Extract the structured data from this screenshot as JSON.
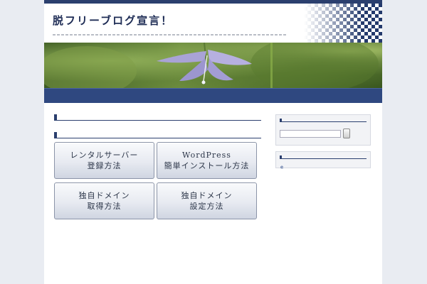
{
  "site": {
    "title": "脱フリーブログ宣言！",
    "description": ""
  },
  "nav": [
    {
      "label": ""
    },
    {
      "label": ""
    },
    {
      "label": ""
    },
    {
      "label": ""
    },
    {
      "label": ""
    },
    {
      "label": ""
    },
    {
      "label": ""
    }
  ],
  "post": {
    "title": "",
    "p1": "",
    "p2_highlight": "",
    "p2": "",
    "p3": "",
    "p3_link": "",
    "p3_tail": ""
  },
  "guides": {
    "section_title": "",
    "buttons": [
      {
        "line1": "レンタルサーバー",
        "line2": "登録方法"
      },
      {
        "line1": "WordPress",
        "line2": "簡単インストール方法"
      },
      {
        "line1": "独自ドメイン",
        "line2": "取得方法"
      },
      {
        "line1": "独自ドメイン",
        "line2": "設定方法"
      }
    ]
  },
  "sidebar": {
    "search": {
      "title": "",
      "placeholder": "",
      "button": ""
    },
    "categories": {
      "title": "",
      "groups": [
        {
          "heading": "",
          "items": [
            "",
            "",
            "",
            ""
          ]
        },
        {
          "heading": "",
          "items": [
            "",
            "",
            "",
            ""
          ]
        },
        {
          "heading": "",
          "items": [
            "",
            "",
            "",
            ""
          ]
        }
      ]
    }
  },
  "colors": {
    "navy": "#2b3f6e",
    "nav_bg": "#2f4880",
    "link": "#1f3aa0",
    "highlight": "#e03030",
    "bullet_icon": "#7d8fb5"
  },
  "icons": {
    "bullet": "list-bullet-icon",
    "checker": "checker-pattern",
    "flower": "bellflower-photo"
  }
}
